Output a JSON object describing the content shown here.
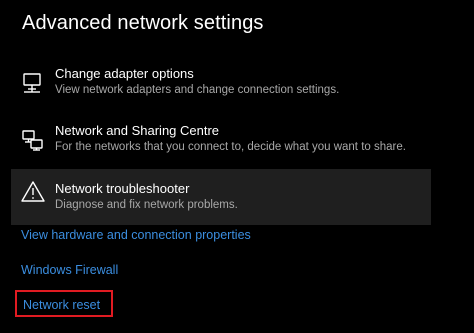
{
  "page": {
    "title": "Advanced network settings"
  },
  "options": [
    {
      "title": "Change adapter options",
      "description": "View network adapters and change connection settings.",
      "icon": "monitor-network-icon"
    },
    {
      "title": "Network and Sharing Centre",
      "description": "For the networks that you connect to, decide what you want to share.",
      "icon": "sharing-centre-icon"
    },
    {
      "title": "Network troubleshooter",
      "description": "Diagnose and fix network problems.",
      "icon": "warning-triangle-icon"
    }
  ],
  "links": {
    "hardware_properties": "View hardware and connection properties",
    "windows_firewall": "Windows Firewall",
    "network_reset": "Network reset"
  },
  "colors": {
    "background": "#000000",
    "highlight": "#1f1f1f",
    "link": "#3b8ee0",
    "annotation_box": "#e11b22",
    "secondary_text": "#a8a8a8"
  }
}
